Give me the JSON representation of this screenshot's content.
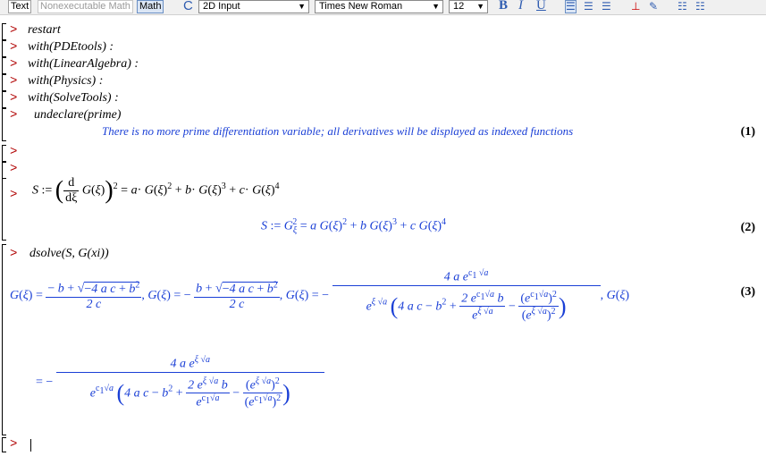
{
  "toolbar": {
    "text_mode": "Text",
    "nonexec_mode": "Nonexecutable Math",
    "math_mode": "Math",
    "input_mode": "2D Input",
    "font": "Times New Roman",
    "size": "12",
    "bold": "B",
    "italic": "I",
    "underline": "U"
  },
  "commands": [
    "restart",
    "with(PDEtools) :",
    "with(LinearAlgebra) :",
    "with(Physics) :",
    "with(SolveTools) :",
    "undeclare(prime)"
  ],
  "undeclare_output": "There is no more prime differentiation variable; all derivatives will be displayed as indexed functions",
  "labels": {
    "eq1": "(1)",
    "eq2": "(2)",
    "eq3": "(3)"
  },
  "prompt_symbol": ">",
  "dsolve_cmd": "dsolve(S, G(xi))",
  "colors": {
    "prompt": "#b00000",
    "output": "#1a3fd6",
    "toolbar": "#f0f0f0"
  }
}
